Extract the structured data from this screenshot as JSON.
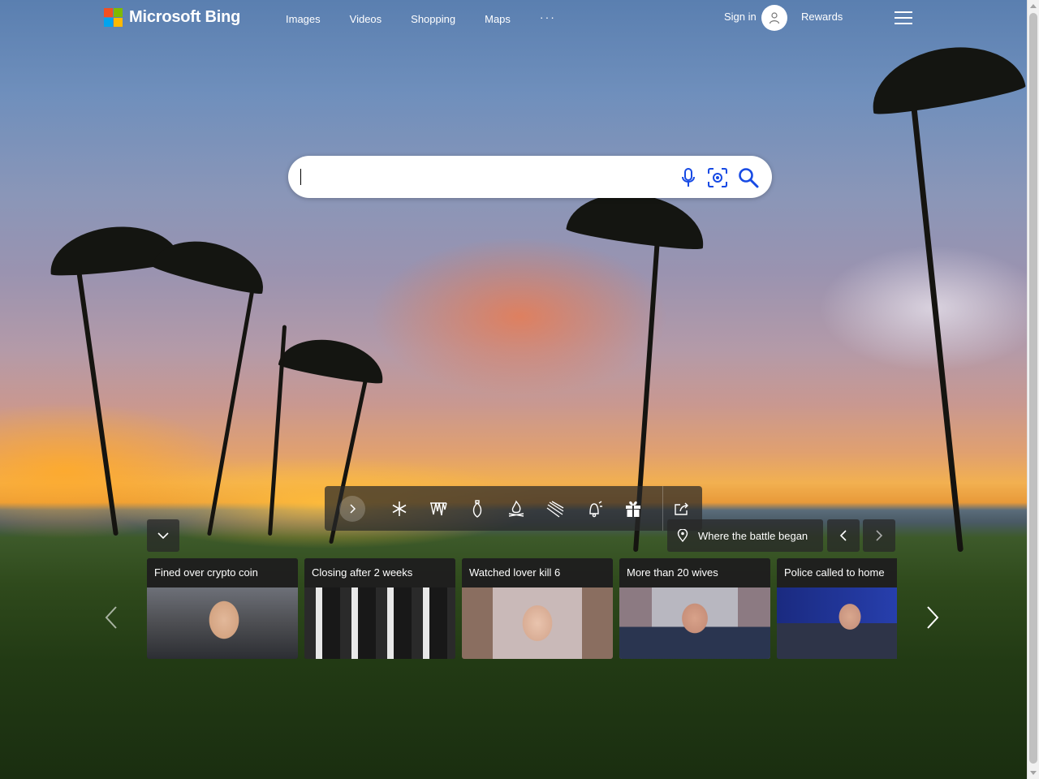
{
  "header": {
    "logo_text": "Microsoft Bing",
    "nav": [
      "Images",
      "Videos",
      "Shopping",
      "Maps",
      "···"
    ],
    "sign_in": "Sign in",
    "rewards": "Rewards"
  },
  "search": {
    "value": "",
    "placeholder": ""
  },
  "toolbar": {
    "icons": [
      "chevron-right-icon",
      "snowflake-icon",
      "icicles-icon",
      "ornament-icon",
      "fire-icon",
      "wind-icon",
      "bell-icon",
      "gift-icon",
      "share-icon"
    ]
  },
  "location": {
    "label": "Where the battle began"
  },
  "news": [
    {
      "title": "Fined over crypto coin"
    },
    {
      "title": "Closing after 2 weeks"
    },
    {
      "title": "Watched lover kill 6"
    },
    {
      "title": "More than 20 wives"
    },
    {
      "title": "Police called to home"
    }
  ],
  "colors": {
    "ms_red": "#f25022",
    "ms_green": "#7fba00",
    "ms_blue": "#00a4ef",
    "ms_yellow": "#ffb900",
    "search_icon_blue": "#174ae4"
  }
}
